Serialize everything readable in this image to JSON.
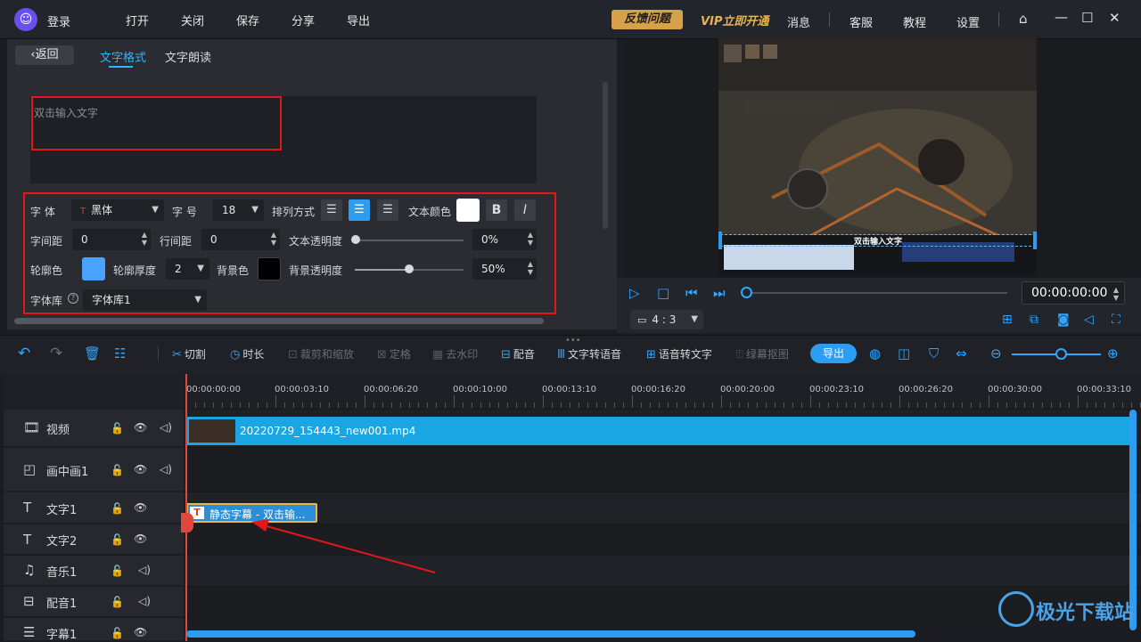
{
  "app": {
    "login": "登录",
    "menu": [
      "打开",
      "关闭",
      "保存",
      "分享",
      "导出"
    ],
    "feedback": "反馈问题",
    "vip": "VIP立即开通",
    "right_menu": [
      "消息",
      "客服",
      "教程",
      "设置"
    ],
    "logo_char": "☺"
  },
  "editor": {
    "back": "返回",
    "tabs": [
      "文字格式",
      "文字朗读"
    ],
    "placeholder": "双击输入文字",
    "font_label": "字 体",
    "font_value": "黑体",
    "size_label": "字 号",
    "size_value": "18",
    "align_label": "排列方式",
    "color_label": "文本颜色",
    "letter_spacing_label": "字间距",
    "letter_spacing_value": "0",
    "line_spacing_label": "行间距",
    "line_spacing_value": "0",
    "text_opacity_label": "文本透明度",
    "text_opacity_value": "0%",
    "text_opacity_level": 0,
    "outline_color_label": "轮廓色",
    "outline_color": "#4aa3ff",
    "outline_width_label": "轮廓厚度",
    "outline_width_value": "2",
    "bg_color_label": "背景色",
    "bg_color": "#000000",
    "bg_opacity_label": "背景透明度",
    "bg_opacity_value": "50%",
    "bg_opacity_level": 0.5,
    "fontlib_label": "字体库",
    "fontlib_value": "字体库1",
    "text_color": "#ffffff"
  },
  "preview": {
    "caption_overlay": "双击输入文字",
    "time": "00:00:00:00",
    "ratio": "4 : 3",
    "progress": 0
  },
  "toolbar": {
    "items": [
      "切割",
      "时长",
      "裁剪和缩放",
      "定格",
      "去水印",
      "配音",
      "文字转语音",
      "语音转文字",
      "绿幕抠图"
    ],
    "export": "导出"
  },
  "timeline": {
    "ticks": [
      "00:00:00:00",
      "00:00:03:10",
      "00:00:06:20",
      "00:00:10:00",
      "00:00:13:10",
      "00:00:16:20",
      "00:00:20:00",
      "00:00:23:10",
      "00:00:26:20",
      "00:00:30:00",
      "00:00:33:10"
    ],
    "tracks": [
      "视频",
      "画中画1",
      "文字1",
      "文字2",
      "音乐1",
      "配音1",
      "字幕1"
    ],
    "video_clip": "20220729_154443_new001.mp4",
    "text_clip": "静态字幕 - 双击输..."
  },
  "watermark": "极光下载站"
}
